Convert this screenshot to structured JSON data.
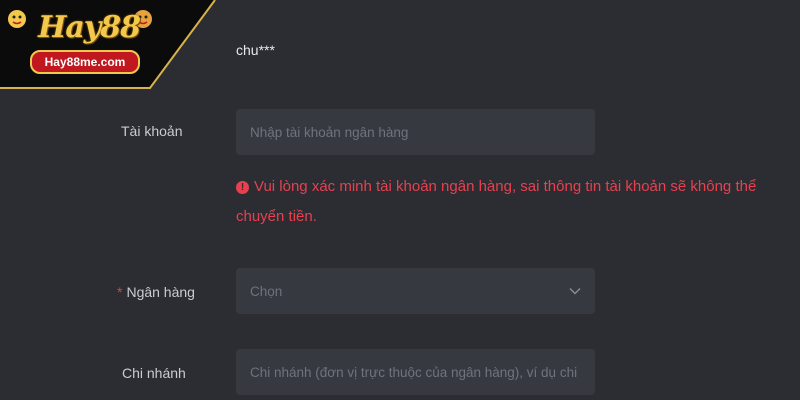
{
  "logo": {
    "title": "Hay88",
    "badge": "Hay88me.com"
  },
  "form": {
    "username_value": "chu***",
    "account": {
      "label": "Tài khoản",
      "placeholder": "Nhập tài khoản ngân hàng"
    },
    "error": {
      "icon": "alert-circle-icon",
      "message": "Vui lòng xác minh tài khoản ngân hàng, sai thông tin tài khoản sẽ không thể chuyển tiền."
    },
    "bank": {
      "required_mark": "*",
      "label": "Ngân hàng",
      "placeholder": "Chọn",
      "icon": "chevron-down-icon"
    },
    "branch": {
      "label": "Chi nhánh",
      "placeholder": "Chi nhánh (đơn vị trực thuộc của ngân hàng), ví dụ chi nhánh"
    }
  },
  "colors": {
    "background": "#2b2d33",
    "input_background": "#363940",
    "error": "#e8404f",
    "logo_gold": "#f2c94c",
    "logo_red": "#c0181e"
  }
}
